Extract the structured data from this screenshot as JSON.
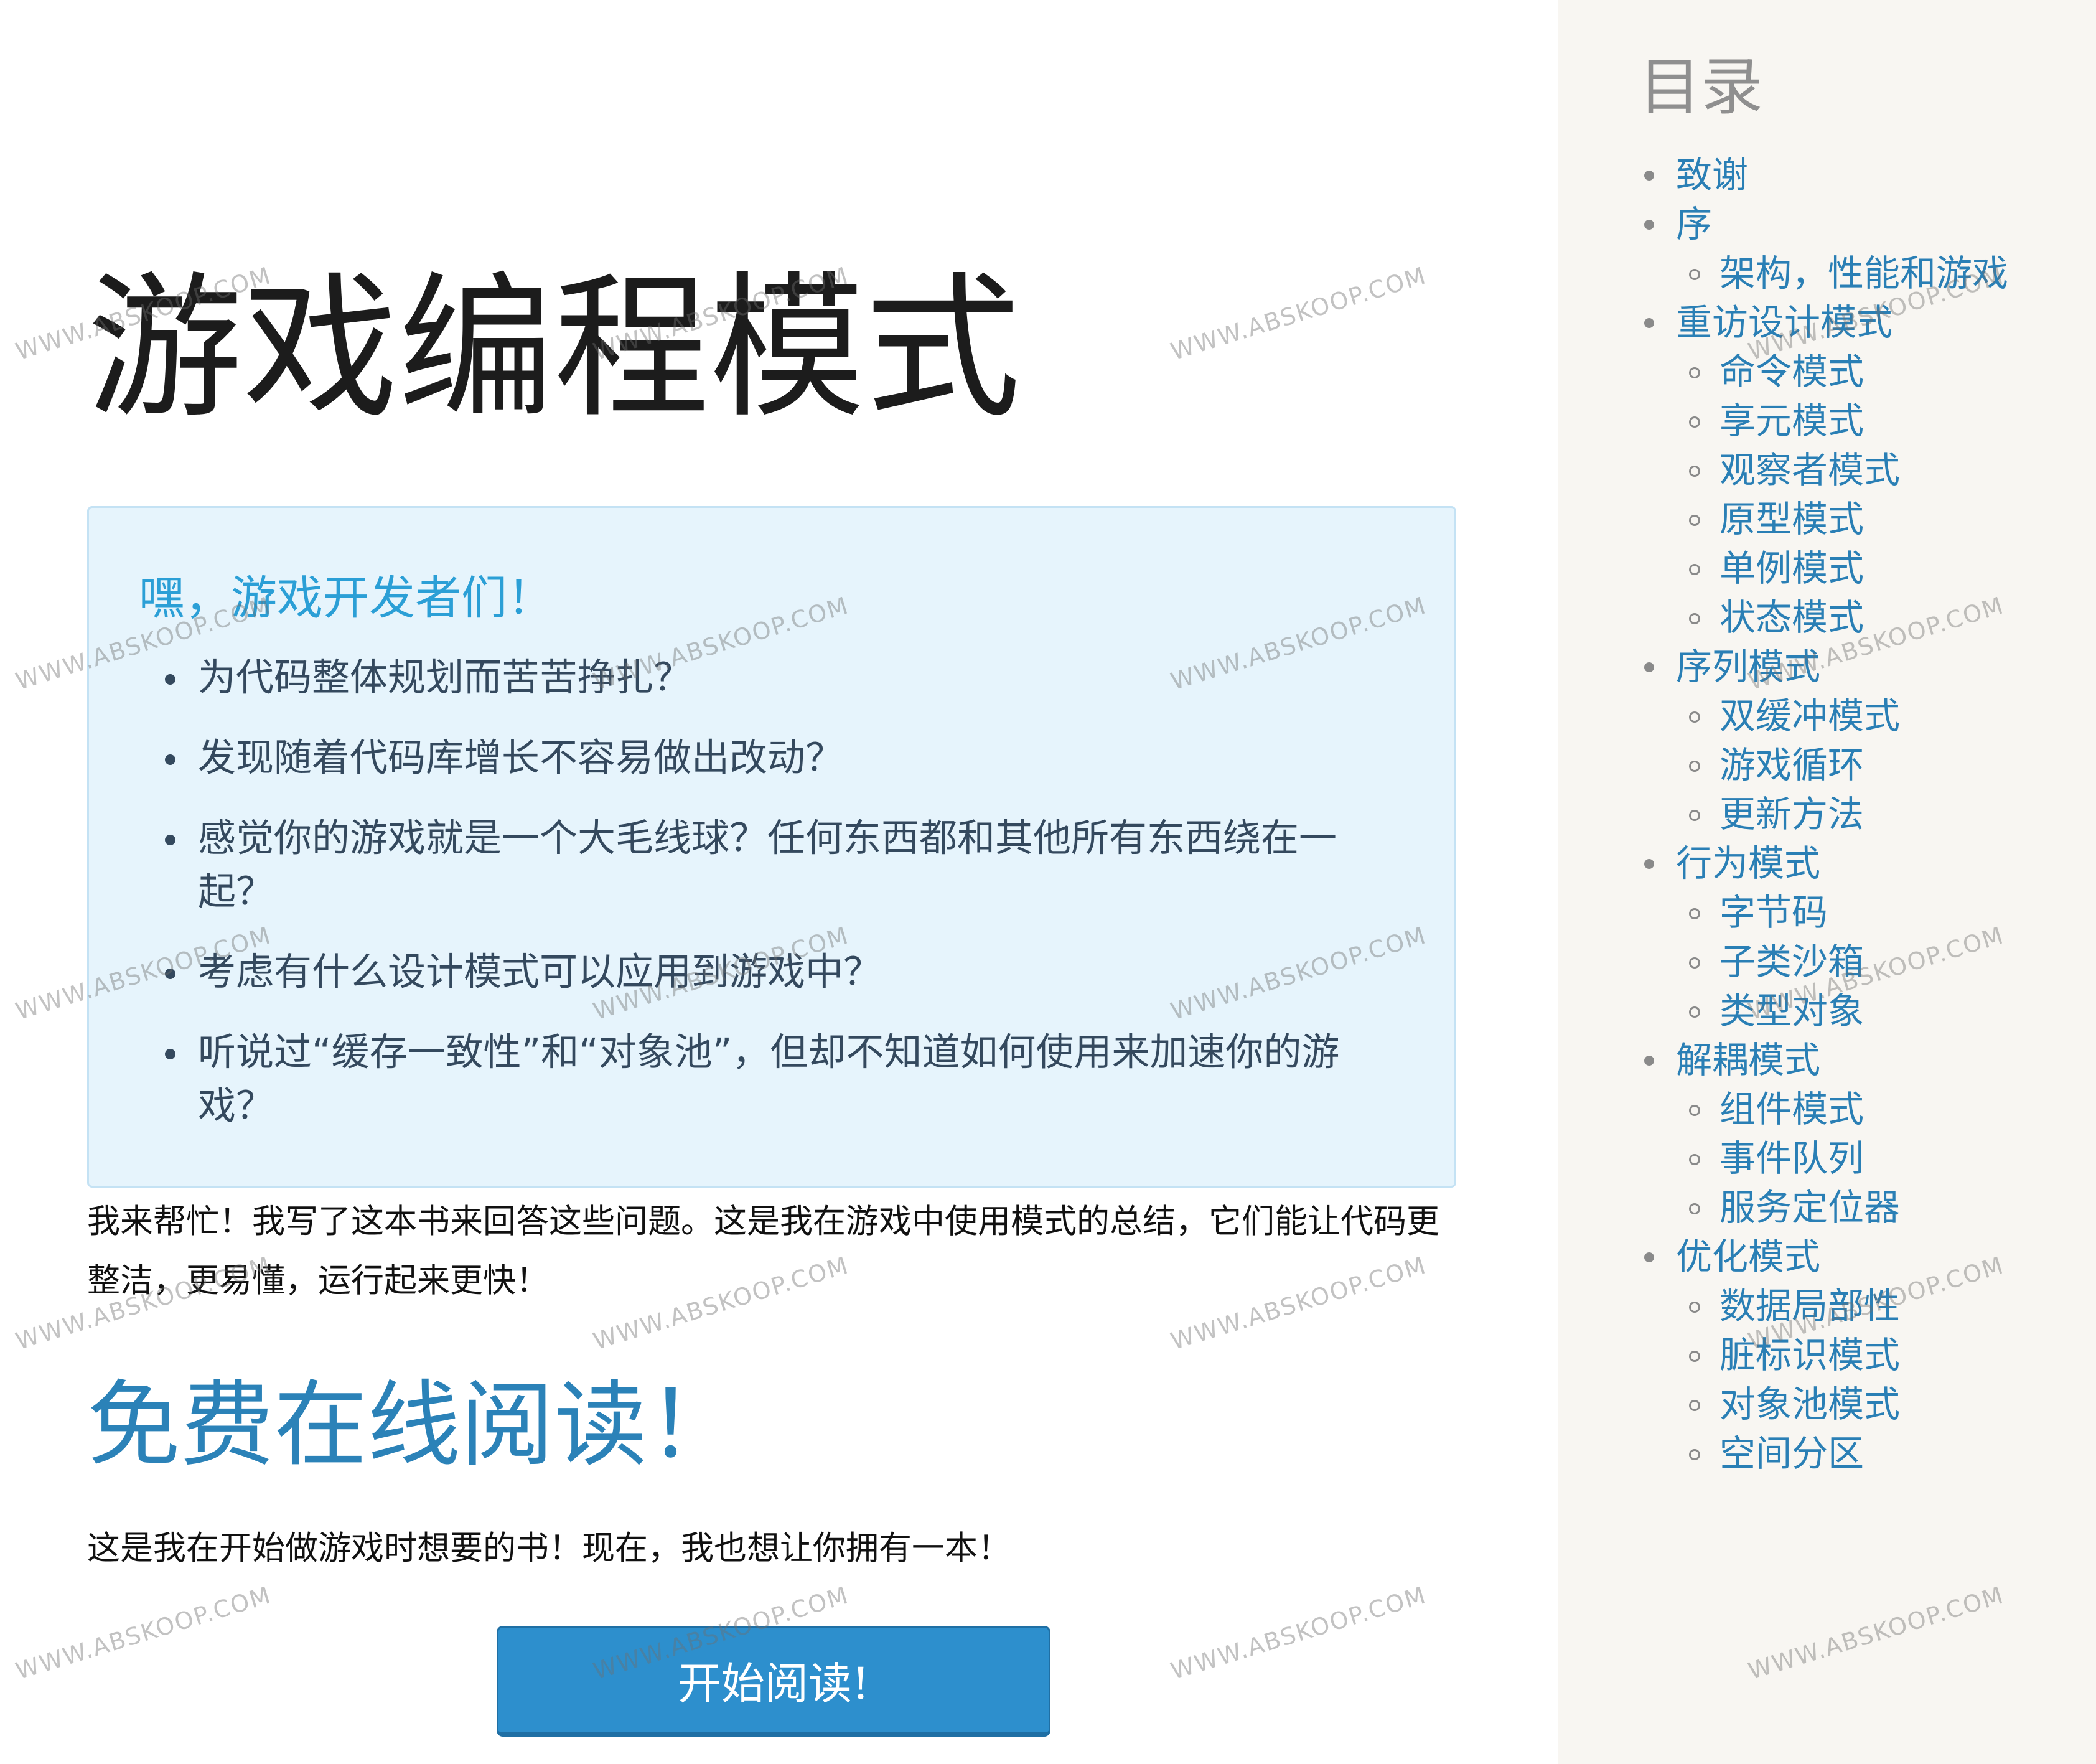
{
  "page": {
    "title": "游戏编程模式"
  },
  "callout": {
    "heading": "嘿，游戏开发者们！",
    "items": [
      "为代码整体规划而苦苦挣扎？",
      "发现随着代码库增长不容易做出改动？",
      "感觉你的游戏就是一个大毛线球？任何东西都和其他所有东西绕在一起？",
      "考虑有什么设计模式可以应用到游戏中？",
      "听说过“缓存一致性”和“对象池”，但却不知道如何使用来加速你的游戏？"
    ]
  },
  "intro": {
    "text": "我来帮忙！我写了这本书来回答这些问题。这是我在游戏中使用模式的总结，它们能让代码更整洁，更易懂，运行起来更快！"
  },
  "read_online": {
    "heading": "免费在线阅读！",
    "text": "这是我在开始做游戏时想要的书！现在，我也想让你拥有一本！",
    "button_label": "开始阅读!"
  },
  "toc": {
    "title": "目录",
    "items": [
      {
        "label": "致谢",
        "level": 1
      },
      {
        "label": "序",
        "level": 1
      },
      {
        "label": "架构，性能和游戏",
        "level": 2
      },
      {
        "label": "重访设计模式",
        "level": 1
      },
      {
        "label": "命令模式",
        "level": 2
      },
      {
        "label": "享元模式",
        "level": 2
      },
      {
        "label": "观察者模式",
        "level": 2
      },
      {
        "label": "原型模式",
        "level": 2
      },
      {
        "label": "单例模式",
        "level": 2
      },
      {
        "label": "状态模式",
        "level": 2
      },
      {
        "label": "序列模式",
        "level": 1
      },
      {
        "label": "双缓冲模式",
        "level": 2
      },
      {
        "label": "游戏循环",
        "level": 2
      },
      {
        "label": "更新方法",
        "level": 2
      },
      {
        "label": "行为模式",
        "level": 1
      },
      {
        "label": "字节码",
        "level": 2
      },
      {
        "label": "子类沙箱",
        "level": 2
      },
      {
        "label": "类型对象",
        "level": 2
      },
      {
        "label": "解耦模式",
        "level": 1
      },
      {
        "label": "组件模式",
        "level": 2
      },
      {
        "label": "事件队列",
        "level": 2
      },
      {
        "label": "服务定位器",
        "level": 2
      },
      {
        "label": "优化模式",
        "level": 1
      },
      {
        "label": "数据局部性",
        "level": 2
      },
      {
        "label": "脏标识模式",
        "level": 2
      },
      {
        "label": "对象池模式",
        "level": 2
      },
      {
        "label": "空间分区",
        "level": 2
      }
    ]
  },
  "watermark": {
    "text": "WWW.ABSKOOP.COM"
  },
  "colors": {
    "link": "#2a7fb5",
    "callout_heading": "#2b9fd6",
    "callout_background": "#e6f4fc",
    "read_heading": "#2b82b8",
    "button": "#2d8fcd",
    "sidebar_background": "#f8f6f2",
    "toc_title": "#8f8f8f"
  }
}
